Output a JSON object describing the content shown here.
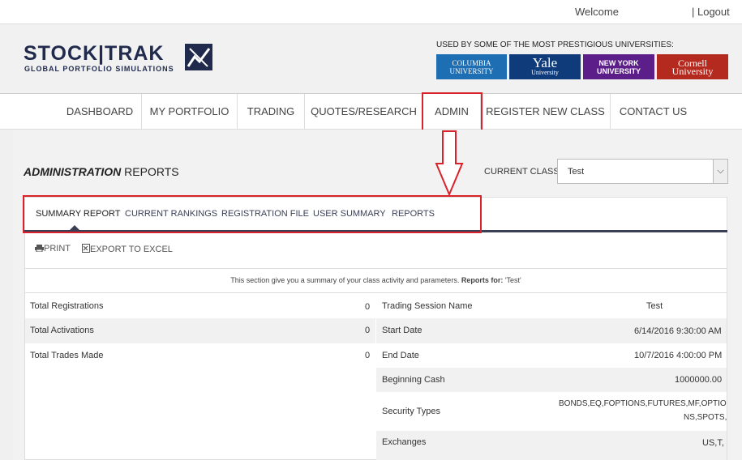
{
  "topbar": {
    "welcome": "Welcome",
    "logout": "| Logout"
  },
  "header": {
    "logo_main": "STOCK|TRAK",
    "logo_sub": "GLOBAL PORTFOLIO SIMULATIONS",
    "used_by": "USED BY SOME OF THE MOST PRESTIGIOUS UNIVERSITIES:",
    "universities": {
      "columbia_1": "COLUMBIA",
      "columbia_2": "UNIVERSITY",
      "yale_1": "Yale",
      "yale_2": "University",
      "nyu_1": "NEW YORK",
      "nyu_2": "UNIVERSITY",
      "cornell_1": "Cornell",
      "cornell_2": "University"
    }
  },
  "nav": {
    "dashboard": "DASHBOARD",
    "portfolio": "MY PORTFOLIO",
    "trading": "TRADING",
    "quotes": "QUOTES/RESEARCH",
    "admin": "ADMIN",
    "register": "REGISTER NEW CLASS",
    "contact": "CONTACT US"
  },
  "page": {
    "title_bold": "ADMINISTRATION",
    "title_rest": " REPORTS",
    "current_class_label": "CURRENT CLASS",
    "current_class_value": "Test",
    "select_arrow": "⌵"
  },
  "tabs": {
    "summary": "SUMMARY REPORT",
    "rankings": "CURRENT RANKINGS",
    "registration": "REGISTRATION FILE",
    "user_summary": "USER SUMMARY",
    "reports": "REPORTS"
  },
  "toolbar": {
    "print": "PRINT",
    "export": "EXPORT TO EXCEL"
  },
  "description": {
    "text": "This section give you a summary of your class activity and parameters. ",
    "reports_for_label": "Reports for:",
    "reports_for_value": " 'Test'"
  },
  "left_rows": [
    {
      "label": "Total Registrations",
      "value": "0"
    },
    {
      "label": "Total Activations",
      "value": "0"
    },
    {
      "label": "Total Trades Made",
      "value": "0"
    }
  ],
  "right_rows": [
    {
      "label": "Trading Session Name",
      "value": "Test"
    },
    {
      "label": "Start Date",
      "value": "6/14/2016 9:30:00 AM"
    },
    {
      "label": "End Date",
      "value": "10/7/2016 4:00:00 PM"
    },
    {
      "label": "Beginning Cash",
      "value": "1000000.00"
    },
    {
      "label": "Security Types",
      "value_1": "BONDS,EQ,FOPTIONS,FUTURES,MF,OPTIO",
      "value_2": "NS,SPOTS,"
    },
    {
      "label": "Exchanges",
      "value": "US,T,"
    }
  ],
  "colors": {
    "highlight": "#d9222a",
    "navy": "#1f2a4d",
    "tab_bar": "#3a3f55"
  },
  "icons": [
    "printer-icon",
    "excel-icon",
    "chevron-down-icon",
    "stocktrak-logo-icon"
  ]
}
